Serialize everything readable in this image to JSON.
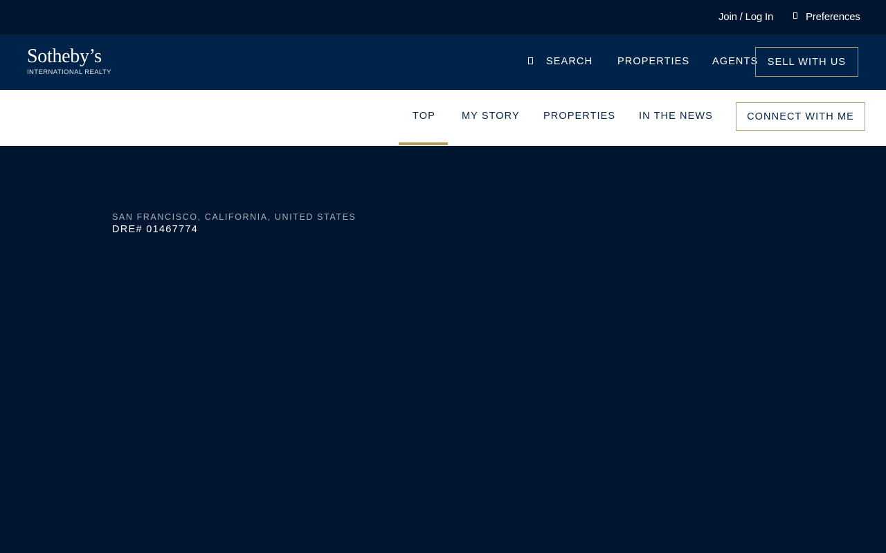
{
  "utility": {
    "join_label": "Join / Log In",
    "preferences_label": "Preferences",
    "preferences_icon": "preferences-icon"
  },
  "header": {
    "logo_main": "Sotheby’s",
    "logo_sub": "INTERNATIONAL REALTY",
    "nav": {
      "search_label": "SEARCH",
      "search_icon": "search-icon",
      "properties_label": "PROPERTIES",
      "agents_label": "AGENTS",
      "sell_label": "SELL WITH US"
    }
  },
  "agent_nav": {
    "items": [
      {
        "label": "TOP",
        "active": true
      },
      {
        "label": "MY STORY",
        "active": false
      },
      {
        "label": "PROPERTIES",
        "active": false
      },
      {
        "label": "IN THE NEWS",
        "active": false
      }
    ],
    "connect_label": "CONNECT WITH ME"
  },
  "hero": {
    "location": "SAN FRANCISCO, CALIFORNIA, UNITED STATES",
    "license": "DRE# 01467774"
  },
  "colors": {
    "navy_dark": "#001530",
    "navy": "#002349",
    "gold": "#b89e5c",
    "white": "#ffffff"
  }
}
